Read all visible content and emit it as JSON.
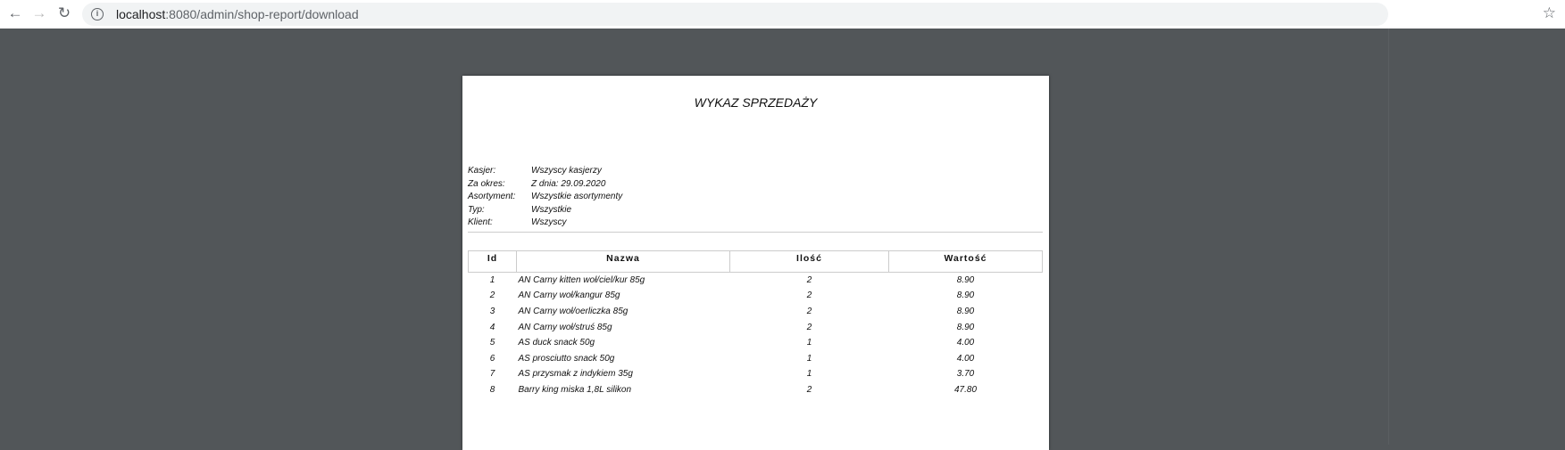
{
  "browser": {
    "url_host": "localhost",
    "url_path": ":8080/admin/shop-report/download"
  },
  "report": {
    "title": "WYKAZ SPRZEDAŻY",
    "meta": [
      {
        "label": "Kasjer:",
        "value": "Wszyscy kasjerzy"
      },
      {
        "label": "Za okres:",
        "value": "Z dnia: 29.09.2020"
      },
      {
        "label": "Asortyment:",
        "value": "Wszystkie asortymenty"
      },
      {
        "label": "Typ:",
        "value": "Wszystkie"
      },
      {
        "label": "Klient:",
        "value": "Wszyscy"
      }
    ],
    "columns": [
      "Id",
      "Nazwa",
      "Ilość",
      "Wartość"
    ],
    "rows": [
      [
        "1",
        "AN Carny kitten woł/ciel/kur 85g",
        "2",
        "8.90"
      ],
      [
        "2",
        "AN Carny woł/kangur 85g",
        "2",
        "8.90"
      ],
      [
        "3",
        "AN Carny woł/oerliczka 85g",
        "2",
        "8.90"
      ],
      [
        "4",
        "AN Carny woł/struś 85g",
        "2",
        "8.90"
      ],
      [
        "5",
        "AS duck snack 50g",
        "1",
        "4.00"
      ],
      [
        "6",
        "AS prosciutto snack 50g",
        "1",
        "4.00"
      ],
      [
        "7",
        "AS przysmak z indykiem 35g",
        "1",
        "3.70"
      ],
      [
        "8",
        "Barry king miska 1,8L silikon",
        "2",
        "47.80"
      ]
    ]
  }
}
